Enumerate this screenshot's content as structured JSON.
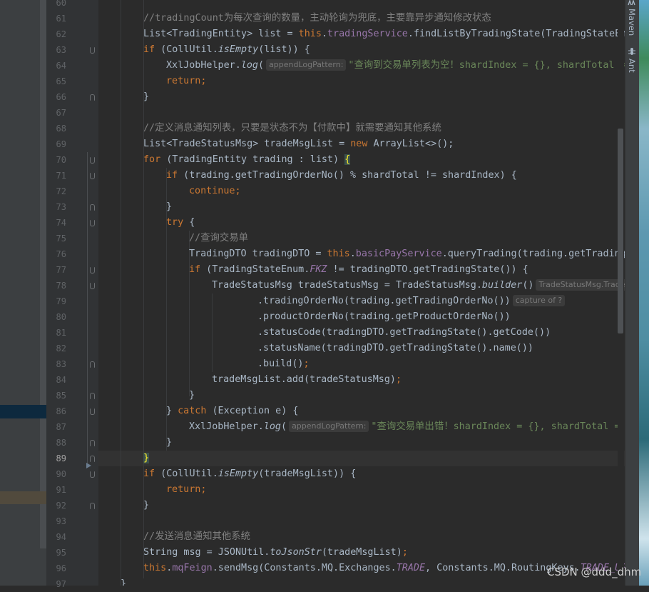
{
  "editor": {
    "line_numbers": [
      "60",
      "61",
      "62",
      "63",
      "64",
      "65",
      "66",
      "67",
      "68",
      "69",
      "70",
      "71",
      "72",
      "73",
      "74",
      "75",
      "76",
      "77",
      "78",
      "79",
      "80",
      "81",
      "82",
      "83",
      "84",
      "85",
      "86",
      "87",
      "88",
      "89",
      "90",
      "91",
      "92",
      "93",
      "94",
      "95",
      "96",
      "97"
    ],
    "code": {
      "l61": "//tradingCount为每次查询的数量，主动轮询为兜底，主要靠异步通知修改状态",
      "l62_a": "List<TradingEntity> list = ",
      "l62_this": "this",
      "l62_b": ".",
      "l62_field": "tradingService",
      "l62_c": ".findListByTradingState(TradingStateEnum",
      "l63_if": "if",
      "l63_a": " (CollUtil.",
      "l63_fn": "isEmpty",
      "l63_b": "(list)) {",
      "l64_a": "XxlJobHelper.",
      "l64_fn": "log",
      "l64_b": "(",
      "l64_hint": "appendLogPattern:",
      "l64_str": "\"查询到交易单列表为空！shardIndex = {}, shardTotal = {}\"",
      "l65_kw": "return",
      "l65_b": ";",
      "l66": "}",
      "l68": "//定义消息通知列表，只要是状态不为【付款中】就需要通知其他系统",
      "l69_a": "List<TradeStatusMsg> tradeMsgList = ",
      "l69_kw": "new",
      "l69_b": " ArrayList<>();",
      "l70_kw": "for",
      "l70_a": " (TradingEntity trading : list) ",
      "l70_brace": "{",
      "l71_kw": "if",
      "l71_a": " (trading.getTradingOrderNo() % shardTotal != shardIndex) {",
      "l72_kw": "continue",
      "l72_b": ";",
      "l73": "}",
      "l74_kw": "try",
      "l74_a": " {",
      "l75": "//查询交易单",
      "l76_a": "TradingDTO tradingDTO = ",
      "l76_this": "this",
      "l76_b": ".",
      "l76_field": "basicPayService",
      "l76_c": ".queryTrading(trading.getTradingOrderNo())",
      "l77_kw": "if",
      "l77_a": " (TradingStateEnum.",
      "l77_const": "FKZ",
      "l77_b": " != tradingDTO.getTradingState()) {",
      "l78_a": "TradeStatusMsg tradeStatusMsg = TradeStatusMsg.",
      "l78_fn": "builder",
      "l78_b": "()",
      "l78_hint": "TradeStatusMsg.TradeStatusMsgBuilder",
      "l79_a": ".tradingOrderNo(trading.getTradingOrderNo())",
      "l79_hint": "capture of ?",
      "l80": ".productOrderNo(trading.getProductOrderNo())",
      "l81": ".statusCode(tradingDTO.getTradingState().getCode())",
      "l82": ".statusName(tradingDTO.getTradingState().name())",
      "l83_a": ".build()",
      "l83_b": ";",
      "l84_a": "tradeMsgList.add(tradeStatusMsg)",
      "l84_b": ";",
      "l85": "}",
      "l86_a": "} ",
      "l86_kw": "catch",
      "l86_b": " (Exception e) {",
      "l87_a": "XxlJobHelper.",
      "l87_fn": "log",
      "l87_b": "(",
      "l87_hint": "appendLogPattern:",
      "l87_str": "\"查询交易单出错！shardIndex = {}, shardTotal = {}\"",
      "l88": "}",
      "l89": "}",
      "l90_kw": "if",
      "l90_a": " (CollUtil.",
      "l90_fn": "isEmpty",
      "l90_b": "(tradeMsgList)) {",
      "l91_kw": "return",
      "l91_b": ";",
      "l92": "}",
      "l94": "//发送消息通知其他系统",
      "l95_a": "String msg = JSONUtil.",
      "l95_fn": "toJsonStr",
      "l95_b": "(tradeMsgList)",
      "l95_c": ";",
      "l96_this": "this",
      "l96_a": ".",
      "l96_field": "mqFeign",
      "l96_b": ".sendMsg(Constants.MQ.Exchanges.",
      "l96_const1": "TRADE",
      "l96_c": ", Constants.MQ.RoutingKeys.",
      "l96_const2": "TRADE_UPDATE_STATUS",
      "l97": "}"
    }
  },
  "right_sidebar": {
    "maven_label": "Maven",
    "ant_label": "Ant"
  },
  "watermark": "CSDN @ddd_dhm",
  "colors": {
    "keyword": "#cc7832",
    "comment": "#808080",
    "field": "#9876aa",
    "method_decl": "#ffc66d",
    "string": "#6a8759",
    "text": "#a9b7c6",
    "background": "#2b2b2b"
  }
}
